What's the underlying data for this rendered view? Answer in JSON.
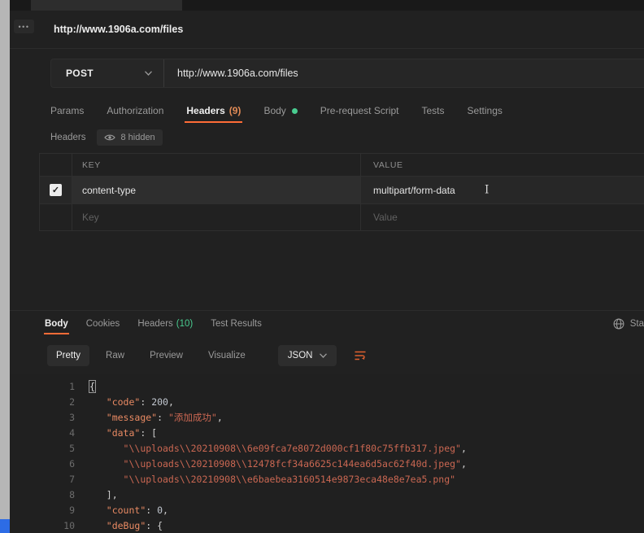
{
  "colors": {
    "accent_orange": "#ff6c37",
    "success_green": "#49cc90"
  },
  "icons": {
    "more_options": "•••",
    "check": "✓",
    "text_caret": "I"
  },
  "request": {
    "title": "http://www.1906a.com/files",
    "method": "POST",
    "url": "http://www.1906a.com/files",
    "tabs": [
      {
        "label": "Params"
      },
      {
        "label": "Authorization"
      },
      {
        "label": "Headers",
        "count": "(9)",
        "active": true
      },
      {
        "label": "Body",
        "dot": true
      },
      {
        "label": "Pre-request Script"
      },
      {
        "label": "Tests"
      },
      {
        "label": "Settings"
      }
    ]
  },
  "headers_editor": {
    "section_label": "Headers",
    "hidden_label": "8 hidden",
    "columns": [
      "KEY",
      "VALUE"
    ],
    "rows": [
      {
        "checked": true,
        "key": "content-type",
        "value": "multipart/form-data"
      }
    ],
    "new_row_placeholders": {
      "key": "Key",
      "value": "Value"
    }
  },
  "response": {
    "tabs": [
      {
        "label": "Body",
        "active": true
      },
      {
        "label": "Cookies"
      },
      {
        "label": "Headers",
        "count": "(10)"
      },
      {
        "label": "Test Results"
      }
    ],
    "status_label_partial": "Sta",
    "view_modes": [
      {
        "label": "Pretty",
        "active": true
      },
      {
        "label": "Raw"
      },
      {
        "label": "Preview"
      },
      {
        "label": "Visualize"
      }
    ],
    "format": "JSON",
    "body_lines": [
      {
        "num": 1,
        "segments": [
          {
            "t": "{",
            "c": "match"
          }
        ]
      },
      {
        "num": 2,
        "segments": [
          {
            "t": "   ",
            "c": "p"
          },
          {
            "t": "\"code\"",
            "c": "key"
          },
          {
            "t": ": ",
            "c": "p"
          },
          {
            "t": "200",
            "c": "num"
          },
          {
            "t": ",",
            "c": "p"
          }
        ]
      },
      {
        "num": 3,
        "segments": [
          {
            "t": "   ",
            "c": "p"
          },
          {
            "t": "\"message\"",
            "c": "key"
          },
          {
            "t": ": ",
            "c": "p"
          },
          {
            "t": "\"添加成功\"",
            "c": "str"
          },
          {
            "t": ",",
            "c": "p"
          }
        ]
      },
      {
        "num": 4,
        "segments": [
          {
            "t": "   ",
            "c": "p"
          },
          {
            "t": "\"data\"",
            "c": "key"
          },
          {
            "t": ": [",
            "c": "p"
          }
        ]
      },
      {
        "num": 5,
        "segments": [
          {
            "t": "      ",
            "c": "p"
          },
          {
            "t": "\"\\\\uploads\\\\20210908\\\\6e09fca7e8072d000cf1f80c75ffb317.jpeg\"",
            "c": "str"
          },
          {
            "t": ",",
            "c": "p"
          }
        ]
      },
      {
        "num": 6,
        "segments": [
          {
            "t": "      ",
            "c": "p"
          },
          {
            "t": "\"\\\\uploads\\\\20210908\\\\12478fcf34a6625c144ea6d5ac62f40d.jpeg\"",
            "c": "str"
          },
          {
            "t": ",",
            "c": "p"
          }
        ]
      },
      {
        "num": 7,
        "segments": [
          {
            "t": "      ",
            "c": "p"
          },
          {
            "t": "\"\\\\uploads\\\\20210908\\\\e6baebea3160514e9873eca48e8e7ea5.png\"",
            "c": "str"
          }
        ]
      },
      {
        "num": 8,
        "segments": [
          {
            "t": "   ],",
            "c": "p"
          }
        ]
      },
      {
        "num": 9,
        "segments": [
          {
            "t": "   ",
            "c": "p"
          },
          {
            "t": "\"count\"",
            "c": "key"
          },
          {
            "t": ": ",
            "c": "p"
          },
          {
            "t": "0",
            "c": "num"
          },
          {
            "t": ",",
            "c": "p"
          }
        ]
      },
      {
        "num": 10,
        "segments": [
          {
            "t": "   ",
            "c": "p"
          },
          {
            "t": "\"deBug\"",
            "c": "key"
          },
          {
            "t": ": {",
            "c": "p"
          }
        ]
      }
    ]
  }
}
